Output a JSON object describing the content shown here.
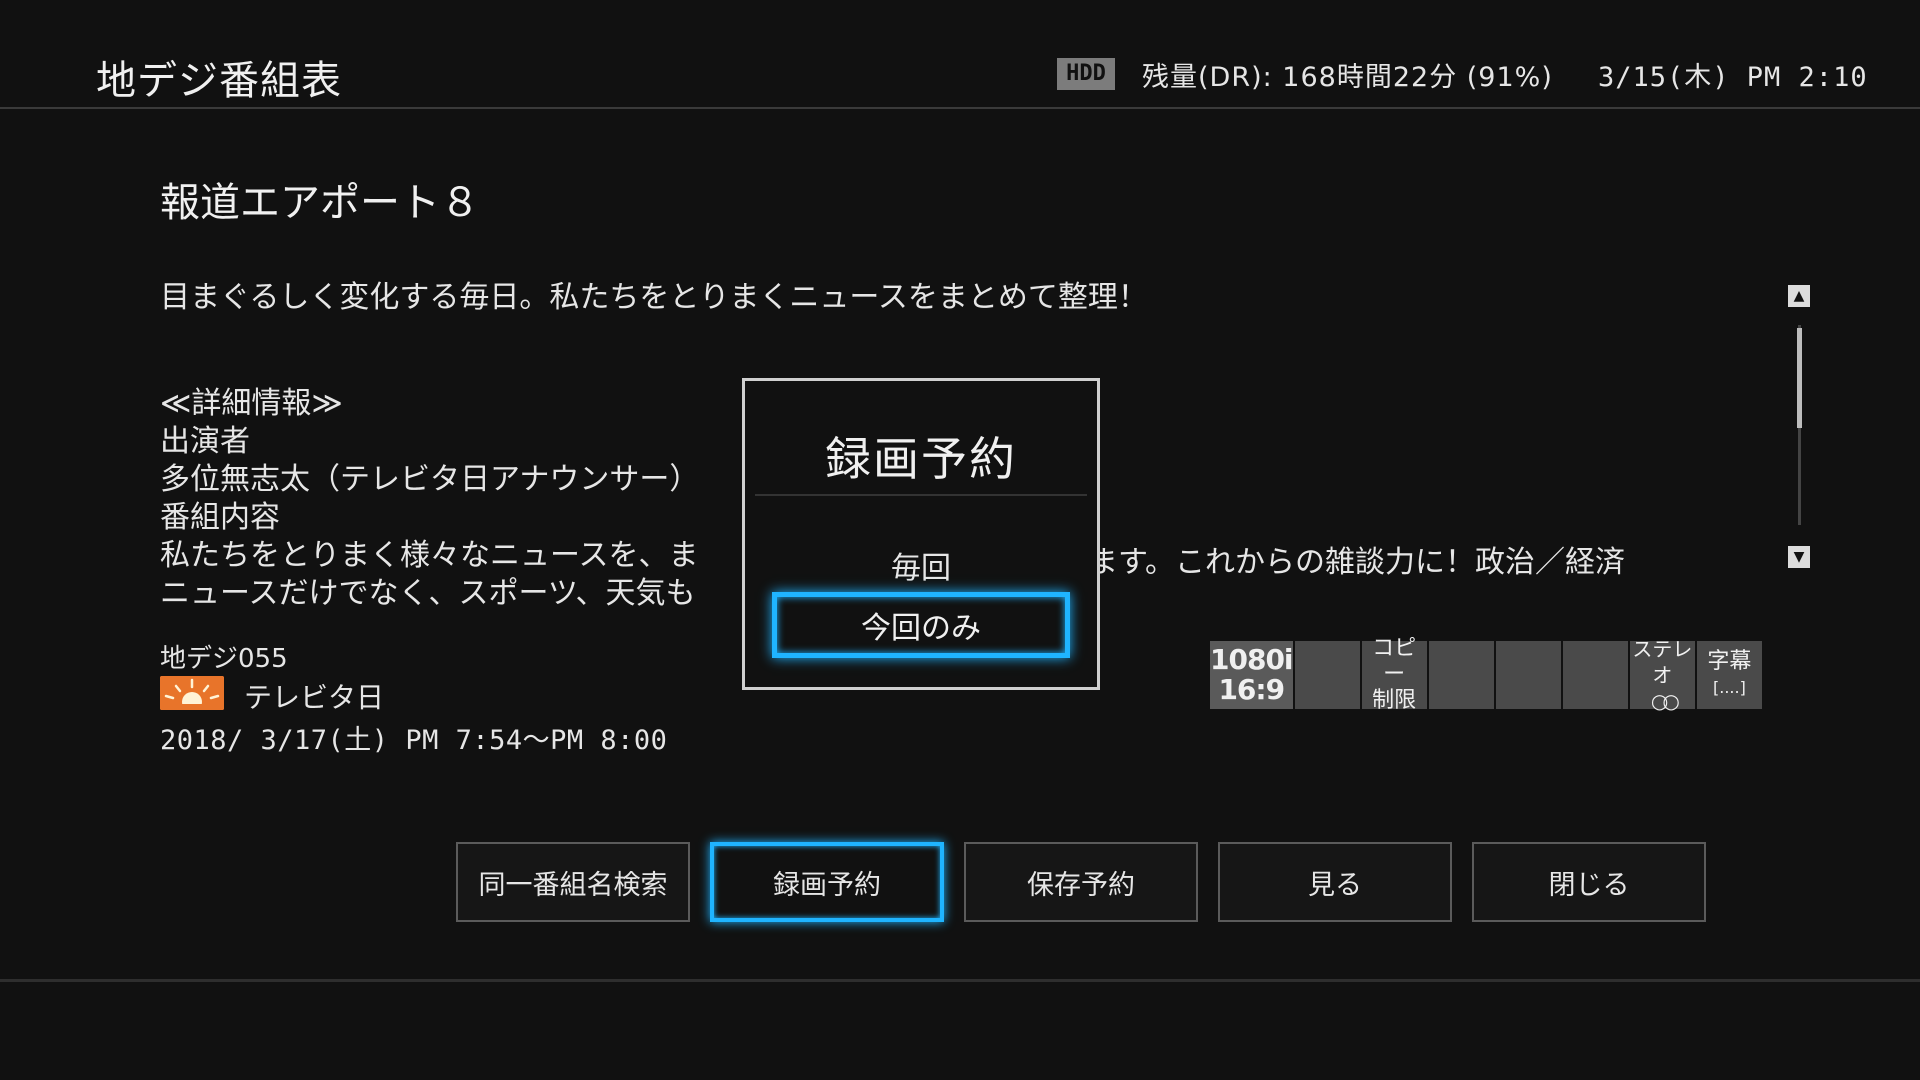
{
  "header": {
    "title": "地デジ番組表",
    "storage_badge": "HDD",
    "storage_text": "残量(DR): 168時間22分 (91%)",
    "clock": "3/15(木) PM 2:10"
  },
  "program": {
    "title": "報道エアポート８",
    "summary": "目まぐるしく変化する毎日。私たちをとりまくニュースをまとめて整理！",
    "details": [
      "≪詳細情報≫",
      "出演者",
      "多位無志太（テレビタ日アナウンサー）",
      "番組内容",
      "私たちをとりまく様々なニュースを、ま",
      "ニュースだけでなく、スポーツ、天気も"
    ],
    "details_right_fragment": "ます。これからの雑談力に！政治／経済",
    "channel_number": "地デジ055",
    "channel_name": "テレビタ日",
    "air_time": "2018/ 3/17(土) PM 7:54～PM 8:00"
  },
  "attributes": {
    "resolution": "1080i",
    "aspect": "16:9",
    "copy_line1": "コピー",
    "copy_line2": "制限",
    "stereo_label": "ステレオ",
    "stereo_symbol": "○○",
    "subtitle_label": "字幕",
    "subtitle_symbol": "[....]"
  },
  "scroll": {
    "up": "▲",
    "down": "▼"
  },
  "buttons": {
    "search_same": "同一番組名検索",
    "record": "録画予約",
    "save": "保存予約",
    "watch": "見る",
    "close": "閉じる"
  },
  "popup": {
    "title": "録画予約",
    "option_every": "毎回",
    "option_once": "今回のみ"
  }
}
